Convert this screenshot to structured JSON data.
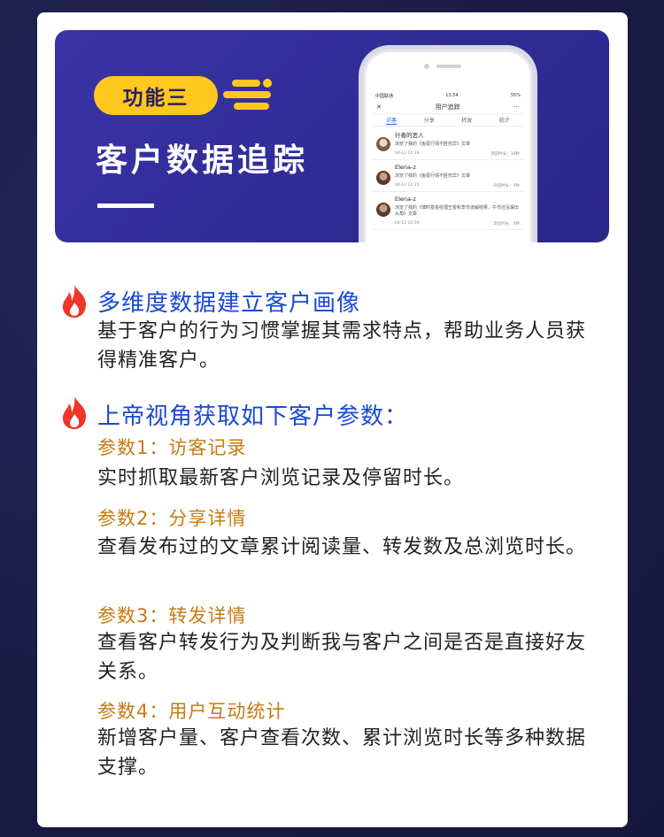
{
  "banner": {
    "badge": "功能三",
    "title": "客户数据追踪"
  },
  "phone": {
    "status": {
      "carrier": "中国联通",
      "time": "13:54",
      "battery": "55%"
    },
    "nav": {
      "close": "✕",
      "title": "用户追踪",
      "more": "···"
    },
    "tabs": [
      "访客",
      "分享",
      "转发",
      "统计"
    ],
    "records": [
      {
        "name": "行善的恶人",
        "desc": "浏览了我的《鱼尾行情不胜伤异》文章",
        "date": "04-12 11:16",
        "duration": "浏览时长：10秒"
      },
      {
        "name": "Elena-z",
        "desc": "浏览了我的《鱼尾行情不胜伤异》文章",
        "date": "04-12 11:15",
        "duration": "浏览时长：0秒"
      },
      {
        "name": "Elena-z",
        "desc": "浏览了我的《博时基金经理王俊和李市道解结果，牛市还没漏出头角》文章",
        "date": "04-12 10:59",
        "duration": "浏览时长：0秒"
      }
    ]
  },
  "section1": {
    "heading": "多维度数据建立客户画像",
    "body": "基于客户的行为习惯掌握其需求特点，帮助业务人员获得精准客户。"
  },
  "section2": {
    "heading": "上帝视角获取如下客户参数：",
    "params": [
      {
        "title": "参数1：访客记录",
        "body": "实时抓取最新客户浏览记录及停留时长。"
      },
      {
        "title": "参数2：分享详情",
        "body": "查看发布过的文章累计阅读量、转发数及总浏览时长。"
      },
      {
        "title": "参数3：转发详情",
        "body": "查看客户转发行为及判断我与客户之间是否是直接好友关系。"
      },
      {
        "title": "参数4：用户互动统计",
        "body": "新增客户量、客户查看次数、累计浏览时长等多种数据支撑。"
      }
    ]
  },
  "colors": {
    "heading": "#1a49d4",
    "param": "#c77a11",
    "badge": "#ffc71f",
    "fire": "#f0352a"
  }
}
